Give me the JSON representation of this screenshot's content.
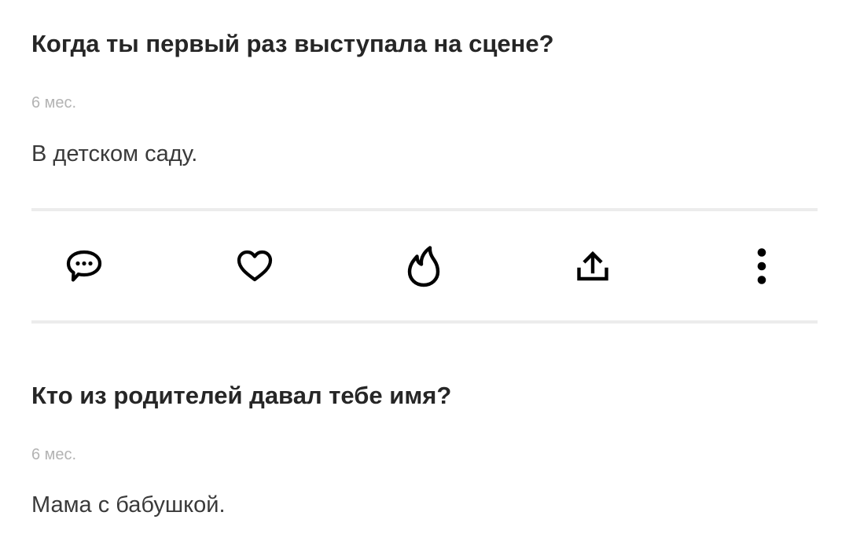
{
  "feed": {
    "posts": [
      {
        "question": "Когда ты первый раз выступала на сцене?",
        "time": "6 мес.",
        "answer": "В детском саду."
      },
      {
        "question": "Кто из родителей давал тебе имя?",
        "time": "6 мес.",
        "answer": "Мама с бабушкой."
      }
    ]
  },
  "actions": {
    "icons": [
      "comment-icon",
      "heart-icon",
      "fire-icon",
      "share-icon",
      "more-vertical-icon"
    ]
  },
  "colors": {
    "text": "#262626",
    "muted": "#b3b3b3",
    "divider": "#ececec",
    "icon": "#000000"
  }
}
